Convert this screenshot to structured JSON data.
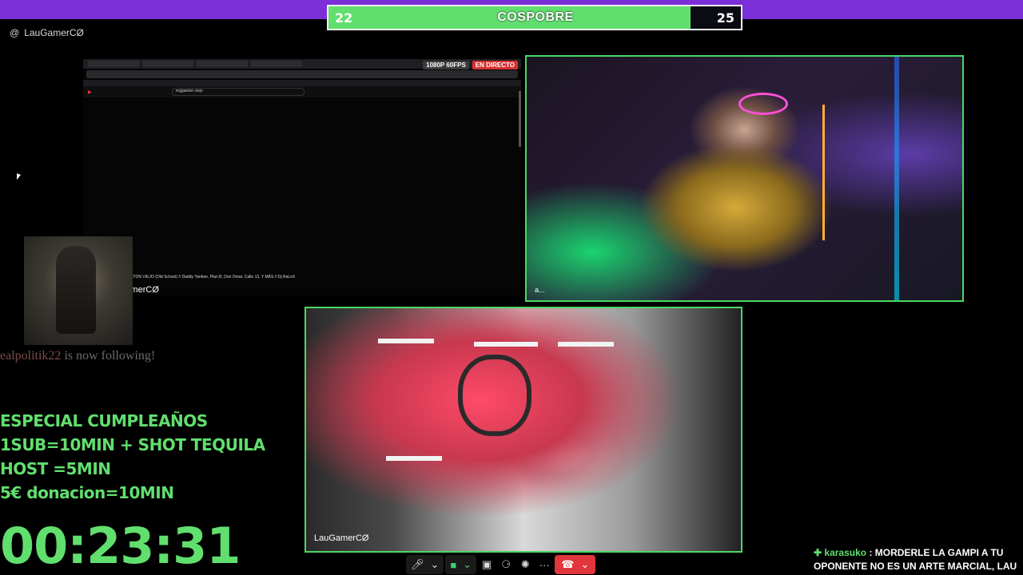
{
  "scoreboard": {
    "left_score": "22",
    "title": "COSPOBRE",
    "right_score": "25"
  },
  "channel": {
    "name": "LauGamerCØ"
  },
  "screen_share": {
    "search_text": "reggaeton viejo",
    "quality_badge": "1080P 60FPS",
    "live_badge": "EN DIRECTO",
    "video_title": "Mix REGGAETON VIEJO (Old School) // Daddy Yankee, Plan B, Don Omar, Calle 13, Y MÁS // Dj RaLoX",
    "owner_label": "LauGamerCØ"
  },
  "participants": [
    {
      "label": "a..."
    },
    {
      "label": "LauGamerCØ"
    }
  ],
  "alert": {
    "user": "ealpolitik22",
    "message": "is now following!"
  },
  "promo": {
    "lines": [
      "ESPECIAL CUMPLEAÑOS",
      "1SUB=10MIN + SHOT TEQUILA",
      "HOST =5MIN",
      "5€ donacion=10MIN"
    ]
  },
  "timer": {
    "value": "00:23:31"
  },
  "chat": {
    "user": "karasuko",
    "message": "MORDERLE LA GAMPI A TU OPONENTE NO ES UN ARTE MARCIAL, LAU"
  },
  "colors": {
    "accent_green": "#61df6e",
    "top_purple": "#7b2fd8",
    "end_call_red": "#e0363c"
  }
}
